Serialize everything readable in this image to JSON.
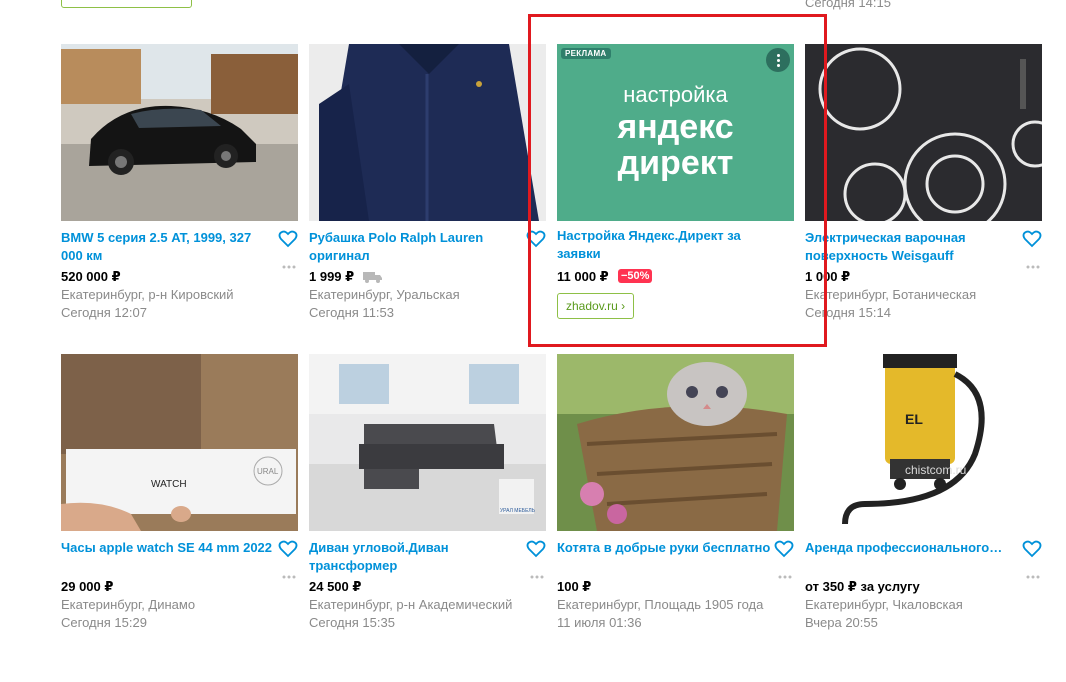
{
  "page": {
    "top_fragment_time": "Сегодня 14:15"
  },
  "listings": [
    {
      "title": "BMW 5 серия 2.5 AT, 1999, 327 000 км",
      "price": "520 000 ₽",
      "location": "Екатеринбург, р-н Кировский",
      "date": "Сегодня 12:07",
      "image": "car-photo"
    },
    {
      "title": "Рубашка Polo Ralph Lauren оригинал",
      "price": "1 999 ₽",
      "location": "Екатеринбург, Уральская",
      "date": "Сегодня 11:53",
      "image": "shirt-photo",
      "delivery_icon": "truck-icon"
    },
    {
      "title": "Электрическая варочная поверхность Weisgauff",
      "price": "1 000 ₽",
      "location": "Екатеринбург, Ботаническая",
      "date": "Сегодня 15:14",
      "image": "cooktop-photo"
    },
    {
      "title": "Часы apple watch SE 44 mm 2022",
      "price": "29 000 ₽",
      "location": "Екатеринбург, Динамо",
      "date": "Сегодня 15:29",
      "image": "watch-box-photo",
      "image_text": {
        "watch": "WATCH",
        "logo": "URAL"
      }
    },
    {
      "title": "Диван угловой.Диван трансформер",
      "price": "24 500 ₽",
      "location": "Екатеринбург, р-н Академический",
      "date": "Сегодня 15:35",
      "image": "sofa-photo",
      "image_text": {
        "logo": "УРАЛ МЕБЕЛЬ"
      }
    },
    {
      "title": "Котята в добрые руки бесплатно",
      "price": "100 ₽",
      "location": "Екатеринбург, Площадь 1905 года",
      "date": "11 июля 01:36",
      "image": "kitten-photo"
    },
    {
      "title": "Аренда профессионального…",
      "price": "от 350 ₽ за услугу",
      "location": "Екатеринбург, Чкаловская",
      "date": "Вчера 20:55",
      "image": "vacuum-photo",
      "image_text": {
        "brand": "EL",
        "watermark": "chistcom.ru"
      }
    }
  ],
  "ad": {
    "badge": "РЕКЛАМА",
    "banner_line1": "настройка",
    "banner_line2": "яндекс",
    "banner_line3": "директ",
    "title": "Настройка Яндекс.Директ за заявки",
    "price": "11 000 ₽",
    "discount": "−50%",
    "link": "zhadov.ru ›",
    "banner_color": "#4fac8a"
  },
  "colors": {
    "title_blue": "#0091d9",
    "highlight_red": "#e0191f",
    "link_green": "#8ec046"
  }
}
